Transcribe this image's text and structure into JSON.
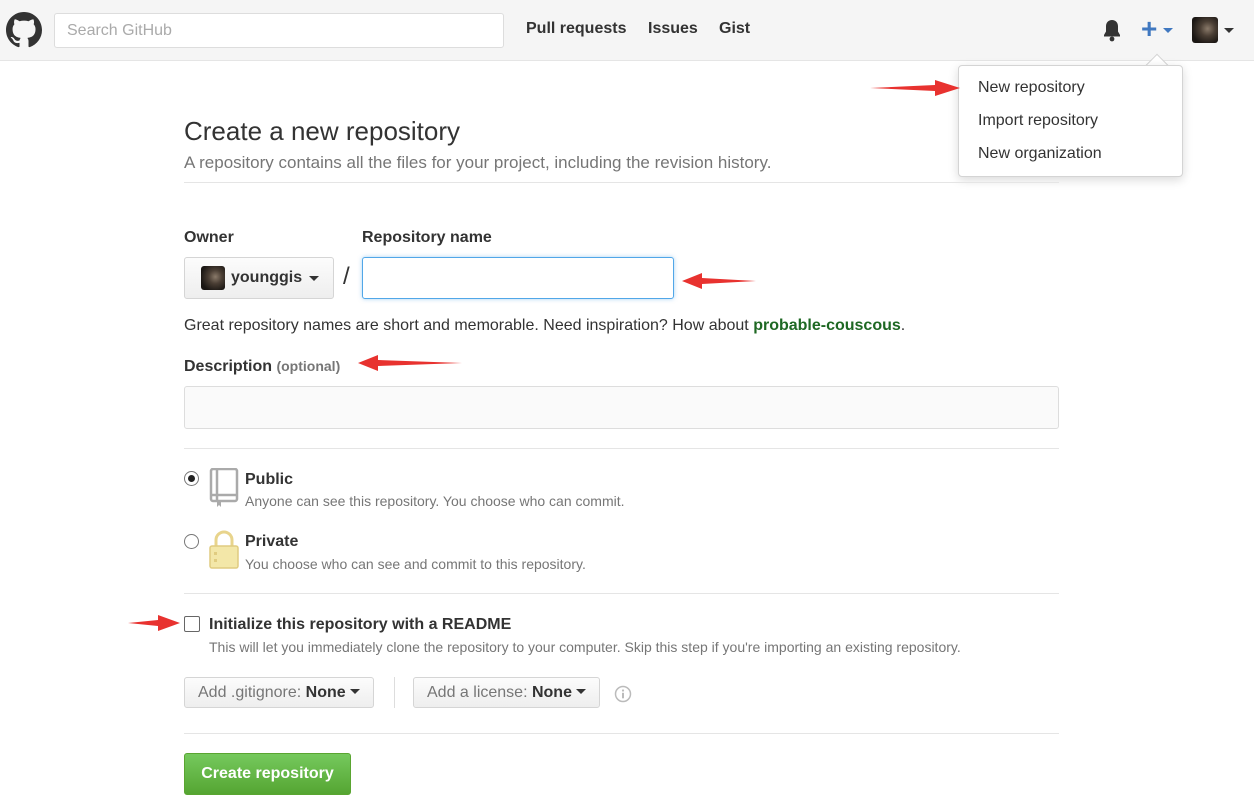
{
  "header": {
    "search_placeholder": "Search GitHub",
    "nav": [
      {
        "label": "Pull requests"
      },
      {
        "label": "Issues"
      },
      {
        "label": "Gist"
      }
    ],
    "plus_symbol": "+"
  },
  "dropdown": {
    "items": [
      {
        "label": "New repository"
      },
      {
        "label": "Import repository"
      },
      {
        "label": "New organization"
      }
    ]
  },
  "page": {
    "title": "Create a new repository",
    "subtitle": "A repository contains all the files for your project, including the revision history."
  },
  "form": {
    "owner_label": "Owner",
    "owner_value": "younggis",
    "slash": "/",
    "repo_name_label": "Repository name",
    "repo_name_value": "",
    "hint_prefix": "Great repository names are short and memorable. Need inspiration? How about ",
    "hint_suggestion": "probable-couscous",
    "hint_suffix": ".",
    "description_label": "Description",
    "description_optional": "(optional)",
    "description_value": "",
    "visibility": {
      "selected": "Public",
      "public_title": "Public",
      "public_desc": "Anyone can see this repository. You choose who can commit.",
      "private_title": "Private",
      "private_desc": "You choose who can see and commit to this repository."
    },
    "readme_label": "Initialize this repository with a README",
    "readme_checked": false,
    "readme_desc": "This will let you immediately clone the repository to your computer. Skip this step if you're importing an existing repository.",
    "gitignore_prefix": "Add .gitignore:",
    "gitignore_value": "None",
    "license_prefix": "Add a license:",
    "license_value": "None",
    "submit_label": "Create repository"
  },
  "colors": {
    "accent_blue": "#4078c0",
    "create_green": "#55a532",
    "suggestion_green": "#1e6823",
    "annotation_red": "#e8322f"
  }
}
